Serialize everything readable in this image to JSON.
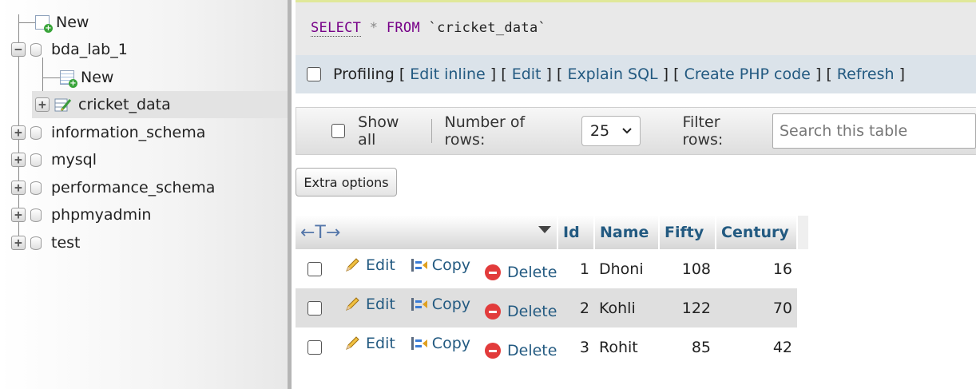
{
  "nav": {
    "tree": [
      {
        "label": "New",
        "kind": "new",
        "level": 0
      },
      {
        "label": "bda_lab_1",
        "kind": "db",
        "level": 0,
        "expanded": true
      },
      {
        "label": "New",
        "kind": "new-table",
        "level": 1
      },
      {
        "label": "cricket_data",
        "kind": "table",
        "level": 1,
        "active": true
      },
      {
        "label": "information_schema",
        "kind": "db",
        "level": 0
      },
      {
        "label": "mysql",
        "kind": "db",
        "level": 0
      },
      {
        "label": "performance_schema",
        "kind": "db",
        "level": 0
      },
      {
        "label": "phpmyadmin",
        "kind": "db",
        "level": 0
      },
      {
        "label": "test",
        "kind": "db",
        "level": 0
      }
    ]
  },
  "query": {
    "select": "SELECT",
    "star": "*",
    "from": "FROM",
    "table": "`cricket_data`"
  },
  "profiling": {
    "label": "Profiling",
    "links": [
      "Edit inline",
      "Edit",
      "Explain SQL",
      "Create PHP code",
      "Refresh"
    ]
  },
  "options": {
    "show_all": "Show all",
    "rows_label": "Number of rows:",
    "rows_value": "25",
    "filter_label": "Filter rows:",
    "filter_placeholder": "Search this table"
  },
  "extra_options": "Extra options",
  "table": {
    "arrows": "←T→",
    "columns": [
      "Id",
      "Name",
      "Fifty",
      "Century"
    ],
    "actions": {
      "edit": "Edit",
      "copy": "Copy",
      "delete": "Delete"
    },
    "rows": [
      {
        "id": "1",
        "name": "Dhoni",
        "fifty": "108",
        "century": "16"
      },
      {
        "id": "2",
        "name": "Kohli",
        "fifty": "122",
        "century": "70"
      },
      {
        "id": "3",
        "name": "Rohit",
        "fifty": "85",
        "century": "42"
      }
    ]
  },
  "colors": {
    "link": "#235a81",
    "keyword": "#770088",
    "delete": "#e23b3b"
  }
}
